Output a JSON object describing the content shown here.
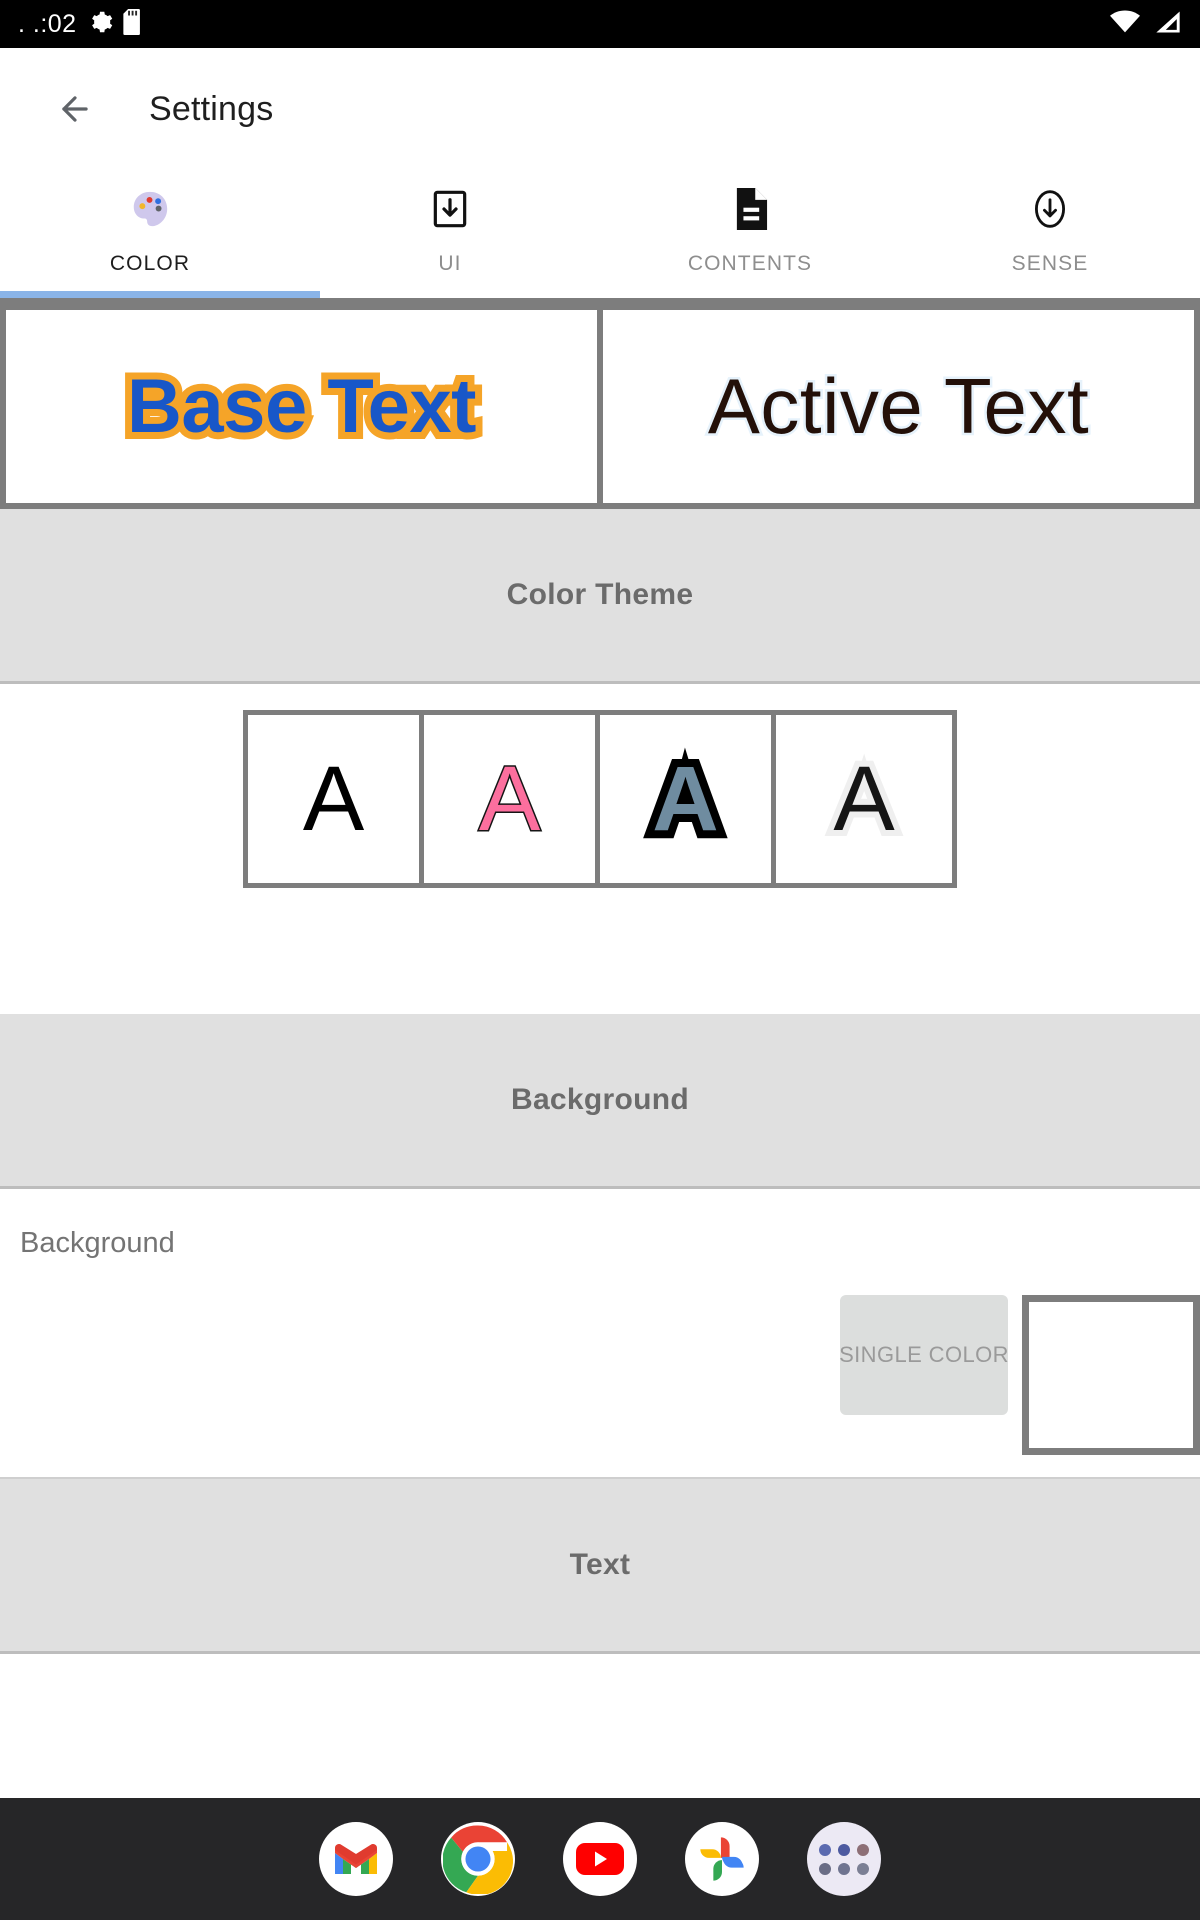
{
  "status_bar": {
    "clock": ". .:02",
    "left_icons": [
      "gear-icon",
      "sd-card-icon"
    ],
    "right_icons": [
      "wifi-icon",
      "cell-signal-icon"
    ],
    "background": "#000000"
  },
  "app_bar": {
    "back_label": "back-arrow",
    "title": "Settings"
  },
  "tabs": {
    "active_index": 0,
    "indicator_color": "#8ab4e8",
    "items": [
      {
        "label": "COLOR",
        "icon": "palette-icon",
        "active": true
      },
      {
        "label": "UI",
        "icon": "download-to-device-icon",
        "active": false
      },
      {
        "label": "CONTENTS",
        "icon": "document-icon",
        "active": false
      },
      {
        "label": "SENSE",
        "icon": "circle-arrow-down-icon",
        "active": false
      }
    ]
  },
  "preview": {
    "base": {
      "text": "Base Text",
      "fill_color": "#1857c8",
      "outline_color": "#f5a428"
    },
    "active": {
      "text": "Active Text",
      "fill_color": "#231009",
      "outline_color": "#e6f2fb"
    }
  },
  "sections": [
    {
      "title": "Color Theme"
    },
    {
      "title": "Background"
    },
    {
      "title": "Text"
    }
  ],
  "color_theme": {
    "title": "Color Theme",
    "swatches": [
      {
        "glyph": "A",
        "name": "theme-plain-black",
        "fill": "#000000",
        "outline": "none"
      },
      {
        "glyph": "A",
        "name": "theme-pink-outlined",
        "fill": "#fc6f9e",
        "outline": "#151515"
      },
      {
        "glyph": "A",
        "name": "theme-steel-heavy-outline",
        "fill": "#6f8ca0",
        "outline": "#000000"
      },
      {
        "glyph": "A",
        "name": "theme-black-light-outline",
        "fill": "#151515",
        "outline": "#efefef"
      }
    ]
  },
  "background_section": {
    "title": "Background",
    "row_label": "Background",
    "mode_button": "SINGLE COLOR",
    "color_chip_value": "#ffffff"
  },
  "text_section": {
    "title": "Text"
  },
  "dock": {
    "background": "#262628",
    "items": [
      {
        "name": "gmail-icon",
        "label": "Gmail"
      },
      {
        "name": "chrome-icon",
        "label": "Chrome"
      },
      {
        "name": "youtube-icon",
        "label": "YouTube"
      },
      {
        "name": "google-photos-icon",
        "label": "Photos"
      },
      {
        "name": "app-drawer-icon",
        "label": "All apps"
      }
    ]
  }
}
